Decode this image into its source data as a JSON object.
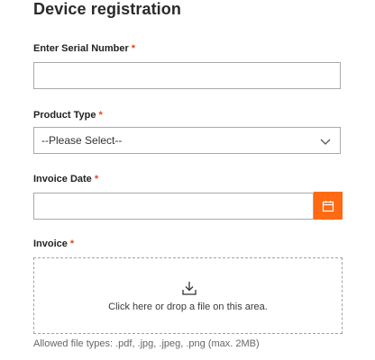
{
  "page": {
    "title": "Device registration"
  },
  "form": {
    "serial": {
      "label": "Enter Serial Number",
      "required_mark": "*",
      "value": ""
    },
    "product_type": {
      "label": "Product Type",
      "required_mark": "*",
      "selected": "--Please Select--"
    },
    "invoice_date": {
      "label": "Invoice Date",
      "required_mark": "*",
      "value": "",
      "button_icon": "calendar-icon"
    },
    "invoice": {
      "label": "Invoice",
      "required_mark": "*",
      "dropzone_icon": "download-icon",
      "dropzone_text": "Click here or drop a file on this area.",
      "allowed_types": "Allowed file types: .pdf, .jpg, .jpeg, .png (max. 2MB)"
    }
  },
  "colors": {
    "accent": "#ff6a13",
    "required": "#e8451c",
    "border": "#a9a9a9"
  }
}
